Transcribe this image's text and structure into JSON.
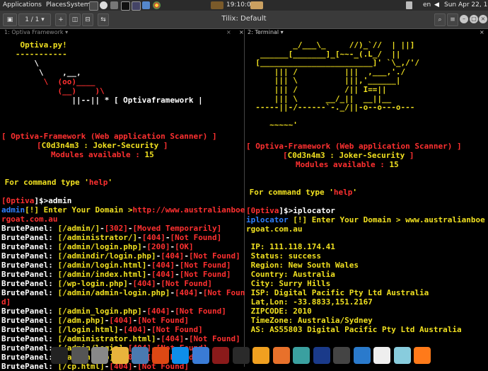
{
  "topbar": {
    "applications": "Applications",
    "places": "Places",
    "system": "System",
    "time_center": "19:10:04",
    "lang": "en",
    "datetime": "Sun Apr 22, 19:10"
  },
  "window": {
    "title": "Tilix: Default",
    "session_counter": "1 / 1"
  },
  "left_pane": {
    "tab": "1: Optiva Framework",
    "banner": [
      "    Optiva.py!",
      "   -----------",
      "       \\",
      "        \\    ,__,",
      "         \\  (oo)____",
      "            (__)    )\\",
      "               ||--|| * [ Optivaframework |"
    ],
    "info_title": "[ Optiva-Framework (Web application Scanner) ]",
    "author_open": "[",
    "author": "C0d3n4m3 : Joker-Security",
    "author_close": "]",
    "modules_label": "Modules available : ",
    "modules_count": "15",
    "help_prefix": " For command type '",
    "help_word": "help",
    "help_suffix": "'",
    "prompt_open": "[",
    "prompt_name": "0ptiva",
    "prompt_close": "]$>",
    "command": "admin",
    "enter_cmd": "admin",
    "enter_text": "[!] Enter Your Domain >",
    "enter_value": "http://www.australianboe",
    "enter_value_2": "rgoat.com.au",
    "results": [
      {
        "label": "BrutePanel: ",
        "path": "[/admin/]",
        "code": "[302]",
        "status": "[Moved Temporarily]"
      },
      {
        "label": "BrutePanel: ",
        "path": "[/administrator/]",
        "code": "[404]",
        "status": "[Not Found]"
      },
      {
        "label": "BrutePanel: ",
        "path": "[/admin/login.php]",
        "code": "[200]",
        "status": "[OK]"
      },
      {
        "label": "BrutePanel: ",
        "path": "[/admindir/login.php]",
        "code": "[404]",
        "status": "[Not Found]"
      },
      {
        "label": "BrutePanel: ",
        "path": "[/admin/login.html]",
        "code": "[404]",
        "status": "[Not Found]"
      },
      {
        "label": "BrutePanel: ",
        "path": "[/admin/index.html]",
        "code": "[404]",
        "status": "[Not Found]"
      },
      {
        "label": "BrutePanel: ",
        "path": "[/wp-login.php]",
        "code": "[404]",
        "status": "[Not Found]"
      },
      {
        "label": "BrutePanel: ",
        "path": "[/admin/admin-login.php]",
        "code": "[404]",
        "status": "[Not Foun"
      },
      {
        "label": "",
        "path": "",
        "code": "",
        "status": "d]"
      },
      {
        "label": "BrutePanel: ",
        "path": "[/admin_login.php]",
        "code": "[404]",
        "status": "[Not Found]"
      },
      {
        "label": "BrutePanel: ",
        "path": "[/adm.php]",
        "code": "[404]",
        "status": "[Not Found]"
      },
      {
        "label": "BrutePanel: ",
        "path": "[/login.html]",
        "code": "[404]",
        "status": "[Not Found]"
      },
      {
        "label": "BrutePanel: ",
        "path": "[/administrator.html]",
        "code": "[404]",
        "status": "[Not Found]"
      },
      {
        "label": "BrutePanel: ",
        "path": "[/admin/login]",
        "code": "[404]",
        "status": "[Not Found]"
      },
      {
        "label": "BrutePanel: ",
        "path": "[/admin.php]",
        "code": "[404]",
        "status": "[Not Found]"
      },
      {
        "label": "BrutePanel: ",
        "path": "[/cp.html]",
        "code": "[404]",
        "status": "[Not Found]"
      }
    ]
  },
  "right_pane": {
    "tab": "2: Terminal",
    "banner": [
      "          _/___\\_     //)_`//  | ||]",
      "   ______[_______]_[~~-_(.L_/  ||",
      "  [________________________]' `\\_,/'/",
      "      ||| /          |||  ,___,'./",
      "      ||| \\          |||,'______|",
      "      ||| /          /|| I==||",
      "      ||| \\      __/_||  __||__",
      "  -----||-/------`-._/||-o--o---o---",
      "",
      "     ~~~~~'"
    ],
    "info_title": "[ Optiva-Framework (Web application Scanner) ]",
    "author_open": "[",
    "author": "C0d3n4m3 : Joker-Security",
    "author_close": "]",
    "modules_label": "Modules available : ",
    "modules_count": "15",
    "help_prefix": " For command type '",
    "help_word": "help",
    "help_suffix": "'",
    "prompt_open": "[",
    "prompt_name": "0ptiva",
    "prompt_close": "]$>",
    "command": "iplocator",
    "enter_cmd": "iplocator",
    "enter_text": " [!] Enter Your Domain > www.australianboe",
    "enter_value_2": "rgoat.com.au",
    "geo": [
      " IP: 111.118.174.41",
      " Status: success",
      " Region: New South Wales",
      " Country: Australia",
      " City: Surry Hills",
      " ISP: Digital Pacific Pty Ltd Australia",
      " Lat,Lon: -33.8833,151.2167",
      " ZIPCODE: 2010",
      " TimeZone: Australia/Sydney",
      " AS: AS55803 Digital Pacific Pty Ltd Australia"
    ]
  },
  "dock": {
    "icons": [
      "terminal-icon",
      "files-icon",
      "workspace-icon",
      "chrome-icon",
      "network-icon",
      "ubuntu-icon",
      "teamviewer-icon",
      "chromium-icon",
      "game-icon",
      "inkscape-icon",
      "nautilus-icon",
      "sublime-icon",
      "avatar-icon",
      "malwarebytes-icon",
      "s-icon",
      "vscode-icon",
      "camera-icon",
      "bookmarks-icon",
      "firefox-icon"
    ]
  }
}
